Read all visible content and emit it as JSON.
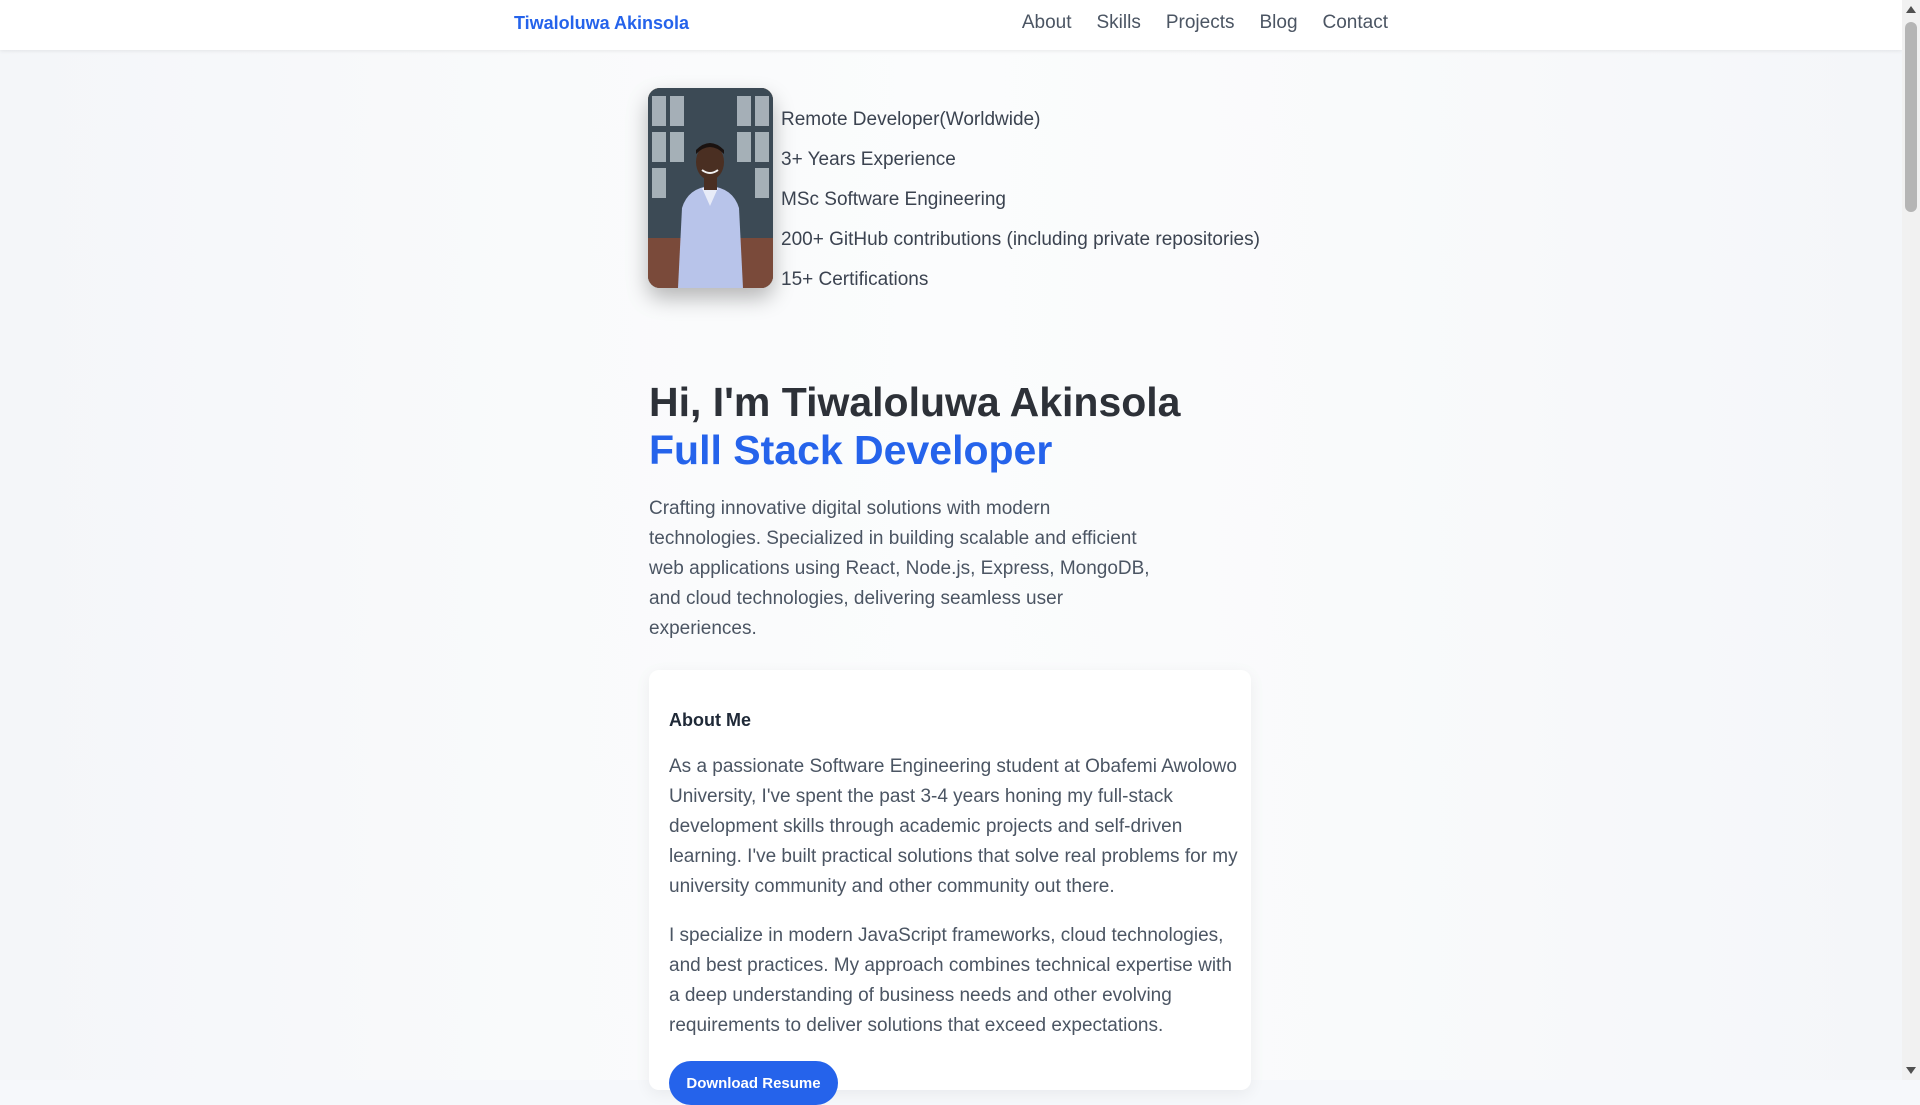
{
  "nav": {
    "brand": "Tiwaloluwa Akinsola",
    "links": [
      "About",
      "Skills",
      "Projects",
      "Blog",
      "Contact"
    ]
  },
  "profile": {
    "highlights": [
      "Remote Developer(Worldwide)",
      "3+ Years Experience",
      "MSc Software Engineering",
      "200+ GitHub contributions (including private repositories)",
      "15+ Certifications"
    ]
  },
  "hero": {
    "greeting": "Hi, I'm Tiwaloluwa Akinsola",
    "role": "Full Stack Developer",
    "description": "Crafting innovative digital solutions with modern technologies. Specialized in building scalable and efficient web applications using React, Node.js, Express, MongoDB, and cloud technologies, delivering seamless user experiences."
  },
  "about": {
    "title": "About Me",
    "paragraph1": "As a passionate Software Engineering student at Obafemi Awolowo University, I've spent the past 3-4 years honing my full-stack development skills through academic projects and self-driven learning. I've built practical solutions that solve real problems for my university community and other community out there.",
    "paragraph2": "I specialize in modern JavaScript frameworks, cloud technologies, and best practices. My approach combines technical expertise with a deep understanding of business needs and other evolving requirements to deliver solutions that exceed expectations.",
    "resume_button": "Download Resume"
  },
  "colors": {
    "accent": "#2563eb",
    "heading": "#2d3138",
    "body_text": "#4b5563"
  }
}
